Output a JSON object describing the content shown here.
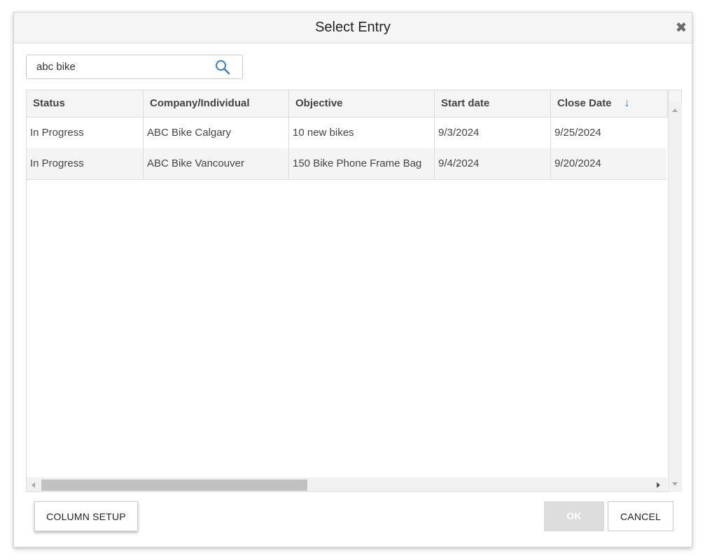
{
  "dialog": {
    "title": "Select Entry",
    "close_icon": "close-icon"
  },
  "search": {
    "value": "abc bike",
    "placeholder": "",
    "icon": "search-icon",
    "icon_color": "#2f7bd0"
  },
  "grid": {
    "columns": [
      {
        "label": "Status"
      },
      {
        "label": "Company/Individual"
      },
      {
        "label": "Objective"
      },
      {
        "label": "Start date"
      },
      {
        "label": "Close Date",
        "sort": "descending",
        "sort_icon": "arrow-down-icon"
      }
    ],
    "rows": [
      {
        "status": "In Progress",
        "company": "ABC Bike Calgary",
        "objective": "10 new bikes",
        "start_date": "9/3/2024",
        "close_date": "9/25/2024"
      },
      {
        "status": "In Progress",
        "company": "ABC Bike Vancouver",
        "objective": "150 Bike Phone Frame Bag",
        "start_date": "9/4/2024",
        "close_date": "9/20/2024"
      }
    ]
  },
  "buttons": {
    "column_setup": "COLUMN SETUP",
    "ok": "OK",
    "cancel": "CANCEL"
  },
  "colors": {
    "accent": "#2f7bd0",
    "disabled_button": "#dddddd"
  }
}
